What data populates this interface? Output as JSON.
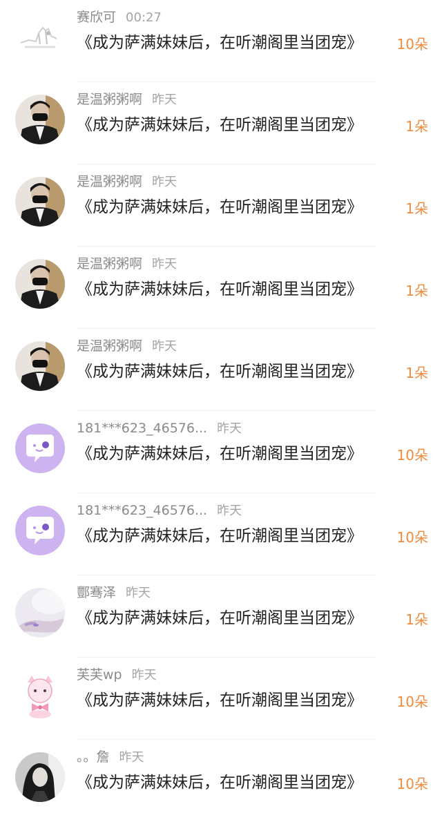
{
  "colors": {
    "count_accent": "#f28a3c",
    "username": "#8a8a8a",
    "title": "#222222",
    "purple_avatar": "#cdb4f0"
  },
  "items": [
    {
      "username": "赛欣可",
      "time": "00:27",
      "gift": "《成为萨满妹妹后，在听潮阁里当团宠》",
      "count": "10朵",
      "avatar": "sketch-avatar"
    },
    {
      "username": "是温粥粥啊",
      "time": "昨天",
      "gift": "《成为萨满妹妹后，在听潮阁里当团宠》",
      "count": "1朵",
      "avatar": "masked-man-avatar"
    },
    {
      "username": "是温粥粥啊",
      "time": "昨天",
      "gift": "《成为萨满妹妹后，在听潮阁里当团宠》",
      "count": "1朵",
      "avatar": "masked-man-avatar"
    },
    {
      "username": "是温粥粥啊",
      "time": "昨天",
      "gift": "《成为萨满妹妹后，在听潮阁里当团宠》",
      "count": "1朵",
      "avatar": "masked-man-avatar"
    },
    {
      "username": "是温粥粥啊",
      "time": "昨天",
      "gift": "《成为萨满妹妹后，在听潮阁里当团宠》",
      "count": "1朵",
      "avatar": "masked-man-avatar"
    },
    {
      "username": "181***623_46576...",
      "time": "昨天",
      "gift": "《成为萨满妹妹后，在听潮阁里当团宠》",
      "count": "10朵",
      "avatar": "default-chat-bubble-avatar"
    },
    {
      "username": "181***623_46576...",
      "time": "昨天",
      "gift": "《成为萨满妹妹后，在听潮阁里当团宠》",
      "count": "10朵",
      "avatar": "default-chat-bubble-avatar"
    },
    {
      "username": "酆骞泽",
      "time": "昨天",
      "gift": "《成为萨满妹妹后，在听潮阁里当团宠》",
      "count": "1朵",
      "avatar": "hand-photo-avatar"
    },
    {
      "username": "芙芙wp",
      "time": "昨天",
      "gift": "《成为萨满妹妹后，在听潮阁里当团宠》",
      "count": "10朵",
      "avatar": "pink-cat-avatar"
    },
    {
      "username": "。。詹",
      "time": "昨天",
      "gift": "《成为萨满妹妹后，在听潮阁里当团宠》",
      "count": "10朵",
      "avatar": "girl-photo-avatar"
    }
  ]
}
